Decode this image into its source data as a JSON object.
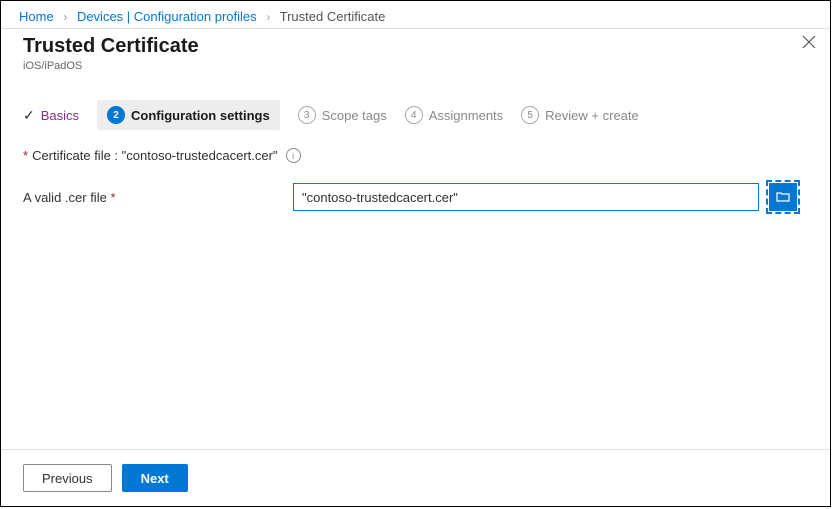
{
  "breadcrumbs": {
    "items": [
      {
        "label": "Home",
        "link": true
      },
      {
        "label": "Devices | Configuration profiles",
        "link": true
      },
      {
        "label": "Trusted Certificate",
        "link": false
      }
    ]
  },
  "header": {
    "title": "Trusted Certificate",
    "subtitle": "iOS/iPadOS"
  },
  "steps": {
    "s1": {
      "label": "Basics"
    },
    "s2": {
      "num": "2",
      "label": "Configuration settings"
    },
    "s3": {
      "num": "3",
      "label": "Scope tags"
    },
    "s4": {
      "num": "4",
      "label": "Assignments"
    },
    "s5": {
      "num": "5",
      "label": "Review + create"
    }
  },
  "form": {
    "cert_file_label": "Certificate file : \"contoso-trustedcacert.cer\"",
    "valid_cer_label": "A valid .cer file",
    "valid_cer_value": "\"contoso-trustedcacert.cer\""
  },
  "footer": {
    "previous": "Previous",
    "next": "Next"
  },
  "required_marker": "*"
}
